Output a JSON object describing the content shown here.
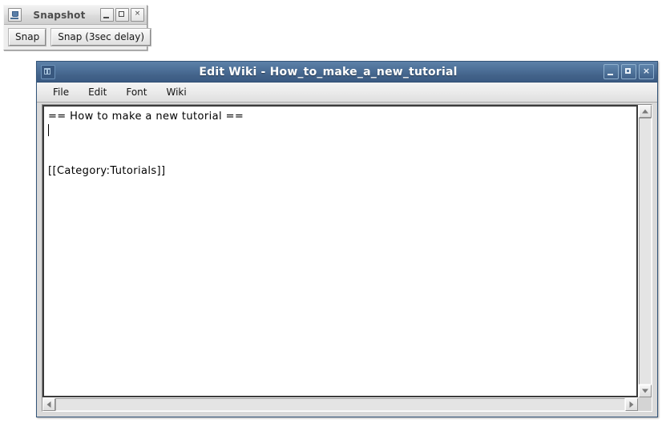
{
  "desktop": {
    "background_color": "#ffffff"
  },
  "snapshot_window": {
    "title": "Snapshot",
    "icon": "java-cup-icon",
    "titlebar_color": "#e2e2e2",
    "controls": [
      {
        "name": "minimize",
        "label": "–"
      },
      {
        "name": "maximize",
        "label": "□"
      },
      {
        "name": "close",
        "label": "×"
      }
    ],
    "buttons": [
      {
        "name": "snap",
        "label": "Snap"
      },
      {
        "name": "snap-delay",
        "label": "Snap (3sec delay)"
      }
    ]
  },
  "editwiki_window": {
    "title": "Edit Wiki - How_to_make_a_new_tutorial",
    "icon": "wiki-app-icon",
    "titlebar_color": "#4a6f96",
    "title_text_color": "#ffffff",
    "controls": [
      {
        "name": "minimize",
        "label": "–"
      },
      {
        "name": "maximize",
        "label": "□"
      },
      {
        "name": "close",
        "label": "×"
      }
    ],
    "menubar": [
      {
        "name": "file",
        "label": "File"
      },
      {
        "name": "edit",
        "label": "Edit"
      },
      {
        "name": "font",
        "label": "Font"
      },
      {
        "name": "wiki",
        "label": "Wiki"
      }
    ],
    "editor": {
      "background_color": "#ffffff",
      "text_color": "#000000",
      "lines": [
        "== How to make a new tutorial ==",
        "",
        "",
        "[[Category:Tutorials]]"
      ],
      "caret_line_index": 2
    },
    "scrollbars": {
      "vertical": {
        "up_label": "▲",
        "down_label": "▼"
      },
      "horizontal": {
        "left_label": "◀",
        "right_label": "▶"
      }
    }
  }
}
